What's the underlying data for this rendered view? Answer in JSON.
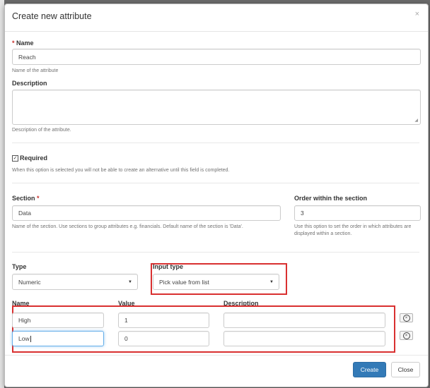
{
  "dialog": {
    "title": "Create new attribute",
    "close_symbol": "×"
  },
  "name_field": {
    "required_marker": "*",
    "label": "Name",
    "value": "Reach",
    "help": "Name of the attribute"
  },
  "description_field": {
    "label": "Description",
    "value": "",
    "help": "Description of the attribute."
  },
  "required_option": {
    "checked": true,
    "label": "Required",
    "help": "When this option is selected you will not be able to create an alternative until this field is completed."
  },
  "section_field": {
    "label": "Section",
    "required_marker": "*",
    "value": "Data",
    "help": "Name of the section. Use sections to group attributes e.g. financials. Default name of the section is 'Data'."
  },
  "order_field": {
    "label": "Order within the section",
    "value": "3",
    "help_line1": "Use this option to set the order in which attributes are",
    "help_line2": "displayed within a section."
  },
  "type_field": {
    "label": "Type",
    "selected": "Numeric"
  },
  "input_type_field": {
    "label": "Input type",
    "selected": "Pick value from list"
  },
  "list_options": {
    "headers": {
      "name": "Name",
      "value": "Value",
      "description": "Description"
    },
    "rows": [
      {
        "name": "High",
        "value": "1",
        "description": ""
      },
      {
        "name": "Low",
        "value": "0",
        "description": ""
      }
    ]
  },
  "footer": {
    "create_label": "Create",
    "close_label": "Close"
  },
  "colors": {
    "primary": "#337ab7",
    "highlight_box": "#d93030",
    "required": "#c9302c"
  }
}
